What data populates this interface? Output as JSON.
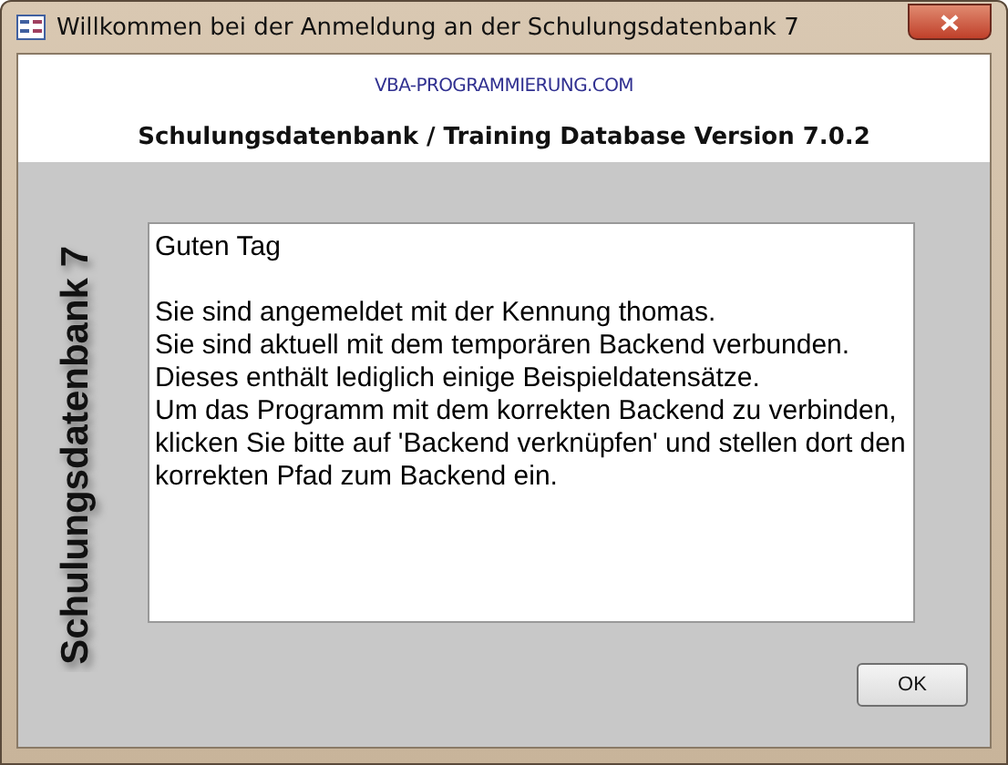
{
  "window": {
    "title": "Willkommen bei der Anmeldung an der Schulungsdatenbank 7"
  },
  "header": {
    "link": "VBA-PROGRAMMIERUNG.COM",
    "title": "Schulungsdatenbank / Training Database Version 7.0.2"
  },
  "side_label": "Schulungsdatenbank 7",
  "message": {
    "paragraphs": [
      "Guten Tag",
      "Sie sind angemeldet mit der Kennung thomas.",
      "Sie sind aktuell mit dem temporären Backend verbunden.",
      "Dieses enthält lediglich einige Beispieldatensätze.",
      "Um das Programm mit dem korrekten Backend zu verbinden, klicken Sie bitte auf 'Backend verknüpfen' und stellen dort den korrekten Pfad zum Backend ein."
    ]
  },
  "buttons": [
    "OK"
  ]
}
